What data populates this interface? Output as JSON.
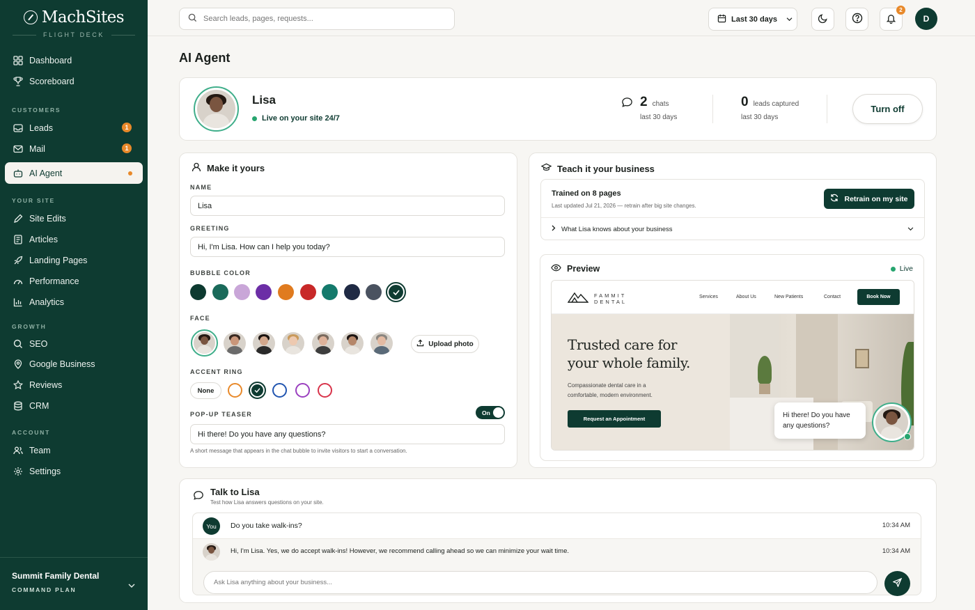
{
  "brand": {
    "name": "MachSites",
    "tagline": "FLIGHT DECK"
  },
  "sidebar": {
    "main": [
      {
        "label": "Dashboard",
        "icon": "grid-icon"
      },
      {
        "label": "Scoreboard",
        "icon": "trophy-icon"
      }
    ],
    "customers_title": "CUSTOMERS",
    "customers": [
      {
        "label": "Leads",
        "badge": "1"
      },
      {
        "label": "Mail",
        "badge": "1"
      },
      {
        "label": "AI Agent"
      }
    ],
    "site_title": "YOUR SITE",
    "site": [
      {
        "label": "Site Edits"
      },
      {
        "label": "Articles"
      },
      {
        "label": "Landing Pages"
      },
      {
        "label": "Performance"
      },
      {
        "label": "Analytics"
      }
    ],
    "growth_title": "GROWTH",
    "growth": [
      {
        "label": "SEO"
      },
      {
        "label": "Google Business"
      },
      {
        "label": "Reviews"
      },
      {
        "label": "CRM"
      }
    ],
    "account_title": "ACCOUNT",
    "account": [
      {
        "label": "Team"
      },
      {
        "label": "Settings"
      }
    ],
    "org": "Summit Family Dental",
    "plan": "COMMAND PLAN"
  },
  "topbar": {
    "search_placeholder": "Search leads, pages, requests...",
    "range": "Last 30 days",
    "notifications": "2",
    "user_initial": "D"
  },
  "page": {
    "title": "AI Agent"
  },
  "agent": {
    "name": "Lisa",
    "status": "Live on your site 24/7",
    "chats_value": "2",
    "chats_label": "chats",
    "chats_period": "last 30 days",
    "leads_value": "0",
    "leads_label": "leads captured",
    "leads_period": "last 30 days",
    "toggle_label": "Turn off"
  },
  "make": {
    "title": "Make it yours",
    "name_label": "NAME",
    "name_value": "Lisa",
    "greeting_label": "GREETING",
    "greeting_value": "Hi, I'm Lisa. How can I help you today?",
    "bubble_label": "BUBBLE COLOR",
    "bubble_colors": [
      "#0d3a30",
      "#1a6a5a",
      "#c9a6d8",
      "#6c2ea6",
      "#e07b1f",
      "#c82828",
      "#147a6c",
      "#1f2a44",
      "#4a5260",
      "#0e3b31"
    ],
    "face_label": "FACE",
    "upload_label": "Upload photo",
    "accent_label": "ACCENT RING",
    "accent_none": "None",
    "accent_colors": [
      "#e8892a",
      "#0e3b31",
      "#2155b0",
      "#9a3fbf",
      "#d8334a"
    ],
    "teaser_label": "POP-UP TEASER",
    "teaser_toggle": "On",
    "teaser_value": "Hi there! Do you have any questions?",
    "teaser_help": "A short message that appears in the chat bubble to invite visitors to start a conversation."
  },
  "teach": {
    "title": "Teach it your business",
    "trained": "Trained on 8 pages",
    "updated": "Last updated Jul 21, 2026 — retrain after big site changes.",
    "retrain_label": "Retrain on my site",
    "knows": "What Lisa knows about your business"
  },
  "preview": {
    "title": "Preview",
    "status": "Live",
    "site_brand_top": "FAMMIT",
    "site_brand_bottom": "DENTAL",
    "nav": [
      "Services",
      "About Us",
      "New Patients",
      "Contact"
    ],
    "book": "Book Now",
    "hero_line1": "Trusted care for",
    "hero_line2": "your whole family.",
    "hero_sub1": "Compassionate dental care in a",
    "hero_sub2": "comfortable, modern environment.",
    "cta": "Request an Appointment",
    "bubble_line1": "Hi there! Do you have",
    "bubble_line2": "any questions?"
  },
  "talk": {
    "title": "Talk to Lisa",
    "subtitle": "Test how Lisa answers questions on your site.",
    "messages": [
      {
        "who": "You",
        "text": "Do you take walk-ins?",
        "time": "10:34 AM"
      },
      {
        "who": "",
        "text": "Hi, I'm Lisa. Yes, we do accept walk-ins! However, we recommend calling ahead so we can minimize your wait time.",
        "time": "10:34 AM"
      }
    ],
    "input_placeholder": "Ask Lisa anything about your business..."
  }
}
